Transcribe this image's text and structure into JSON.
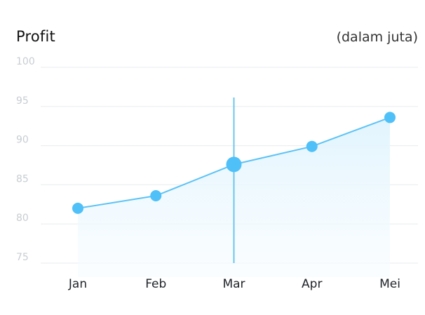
{
  "header": {
    "title": "Profit",
    "unit": "(dalam juta)"
  },
  "colors": {
    "line": "#5cc3f5",
    "point": "#50c0f8",
    "area_top": "#e1f4fe",
    "area_bottom": "#f7fcff",
    "grid": "#e8ebee",
    "cursor": "#6cc6ee"
  },
  "chart_data": {
    "type": "area",
    "title": "Profit",
    "subtitle": "(dalam juta)",
    "categories": [
      "Jan",
      "Feb",
      "Mar",
      "Apr",
      "Mei"
    ],
    "series": [
      {
        "values": [
          82,
          83.6,
          87.6,
          89.9,
          93.6
        ]
      }
    ],
    "ylim": [
      75,
      100
    ],
    "yticks": [
      100,
      95,
      90,
      85,
      80,
      75
    ],
    "grid": true,
    "highlighted_category": "Mar"
  }
}
